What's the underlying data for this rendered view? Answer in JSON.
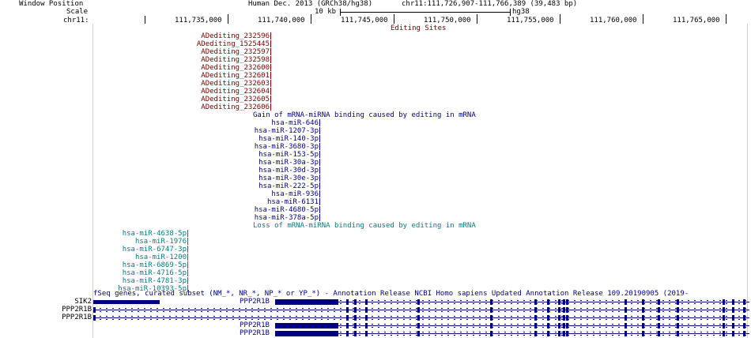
{
  "header": {
    "window_position_label": "Window Position",
    "scale_label": "Scale",
    "chrom_label": "chr11:",
    "assembly": "Human Dec. 2013 (GRCh38/hg38)",
    "position": "chr11:111,726,907-111,766,389 (39,483 bp)",
    "scale_value": "10 kb",
    "scale_db": "hg38"
  },
  "ruler": {
    "ticks": [
      "111,735,000",
      "111,740,000",
      "111,745,000",
      "111,750,000",
      "111,755,000",
      "111,760,000",
      "111,765,000"
    ]
  },
  "editing_sites": {
    "title": "Editing Sites",
    "items": [
      "ADediting_232596",
      "ADediting_1525445",
      "ADediting_232597",
      "ADediting_232598",
      "ADediting_232600",
      "ADediting_232601",
      "ADediting_232603",
      "ADediting_232604",
      "ADediting_232605",
      "ADediting_232606"
    ]
  },
  "gain": {
    "title": "Gain of mRNA-miRNA binding caused by editing in mRNA",
    "items": [
      "hsa-miR-646",
      "hsa-miR-1207-3p",
      "hsa-miR-140-3p",
      "hsa-miR-3680-3p",
      "hsa-miR-153-5p",
      "hsa-miR-30a-3p",
      "hsa-miR-30d-3p",
      "hsa-miR-30e-3p",
      "hsa-miR-222-5p",
      "hsa-miR-936",
      "hsa-miR-6131",
      "hsa-miR-4680-5p",
      "hsa-miR-378a-5p"
    ]
  },
  "loss": {
    "title": "Loss of mRNA-miRNA binding caused by editing in mRNA",
    "items": [
      "hsa-miR-4638-5p",
      "hsa-miR-1976",
      "hsa-miR-6747-3p",
      "hsa-miR-1200",
      "hsa-miR-6869-5p",
      "hsa-miR-4716-5p",
      "hsa-miR-4781-3p",
      "hsa-miR-10393-5p"
    ]
  },
  "genes": {
    "title": "fSeq genes, curated subset (NM_*, NR_*, NP_* or YP_*) - Annotation Release NCBI Homo sapiens Updated Annotation Release 109.20190905 (2019-",
    "side_labels": [
      "SIK2",
      "PPP2R1B",
      "PPP2R1B"
    ],
    "inline_labels": [
      "PPP2R1B",
      "PPP2R1B",
      "PPP2R1B"
    ]
  },
  "colors": {
    "editing": "#7a0000",
    "gain": "#000080",
    "loss": "#008080",
    "gene": "#000080",
    "guide_line": "#f3c0c0"
  }
}
